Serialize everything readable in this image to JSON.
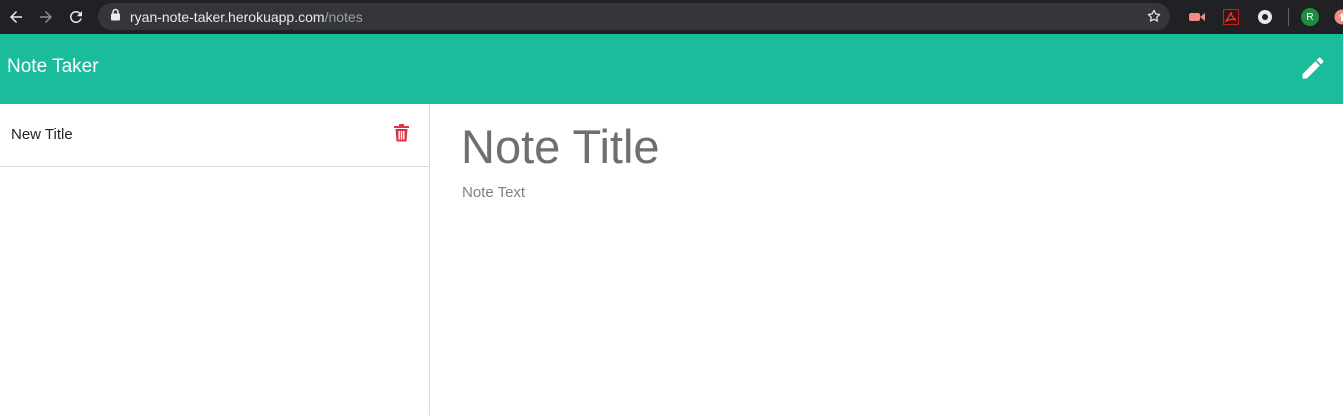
{
  "browser": {
    "url_host": "ryan-note-taker.herokuapp.com",
    "url_path": "/notes",
    "avatar_letter": "R",
    "icons": [
      "back-icon",
      "forward-icon",
      "reload-icon",
      "lock-icon",
      "bookmark-star-icon"
    ]
  },
  "navbar": {
    "brand": "Note Taker",
    "action_icon": "pencil-icon",
    "background": "#1abc9c"
  },
  "sidebar": {
    "items": [
      {
        "title": "New Title",
        "action_icon": "trash-icon",
        "action_color": "#dc3545"
      }
    ]
  },
  "editor": {
    "title_placeholder": "Note Title",
    "text_placeholder": "Note Text"
  }
}
